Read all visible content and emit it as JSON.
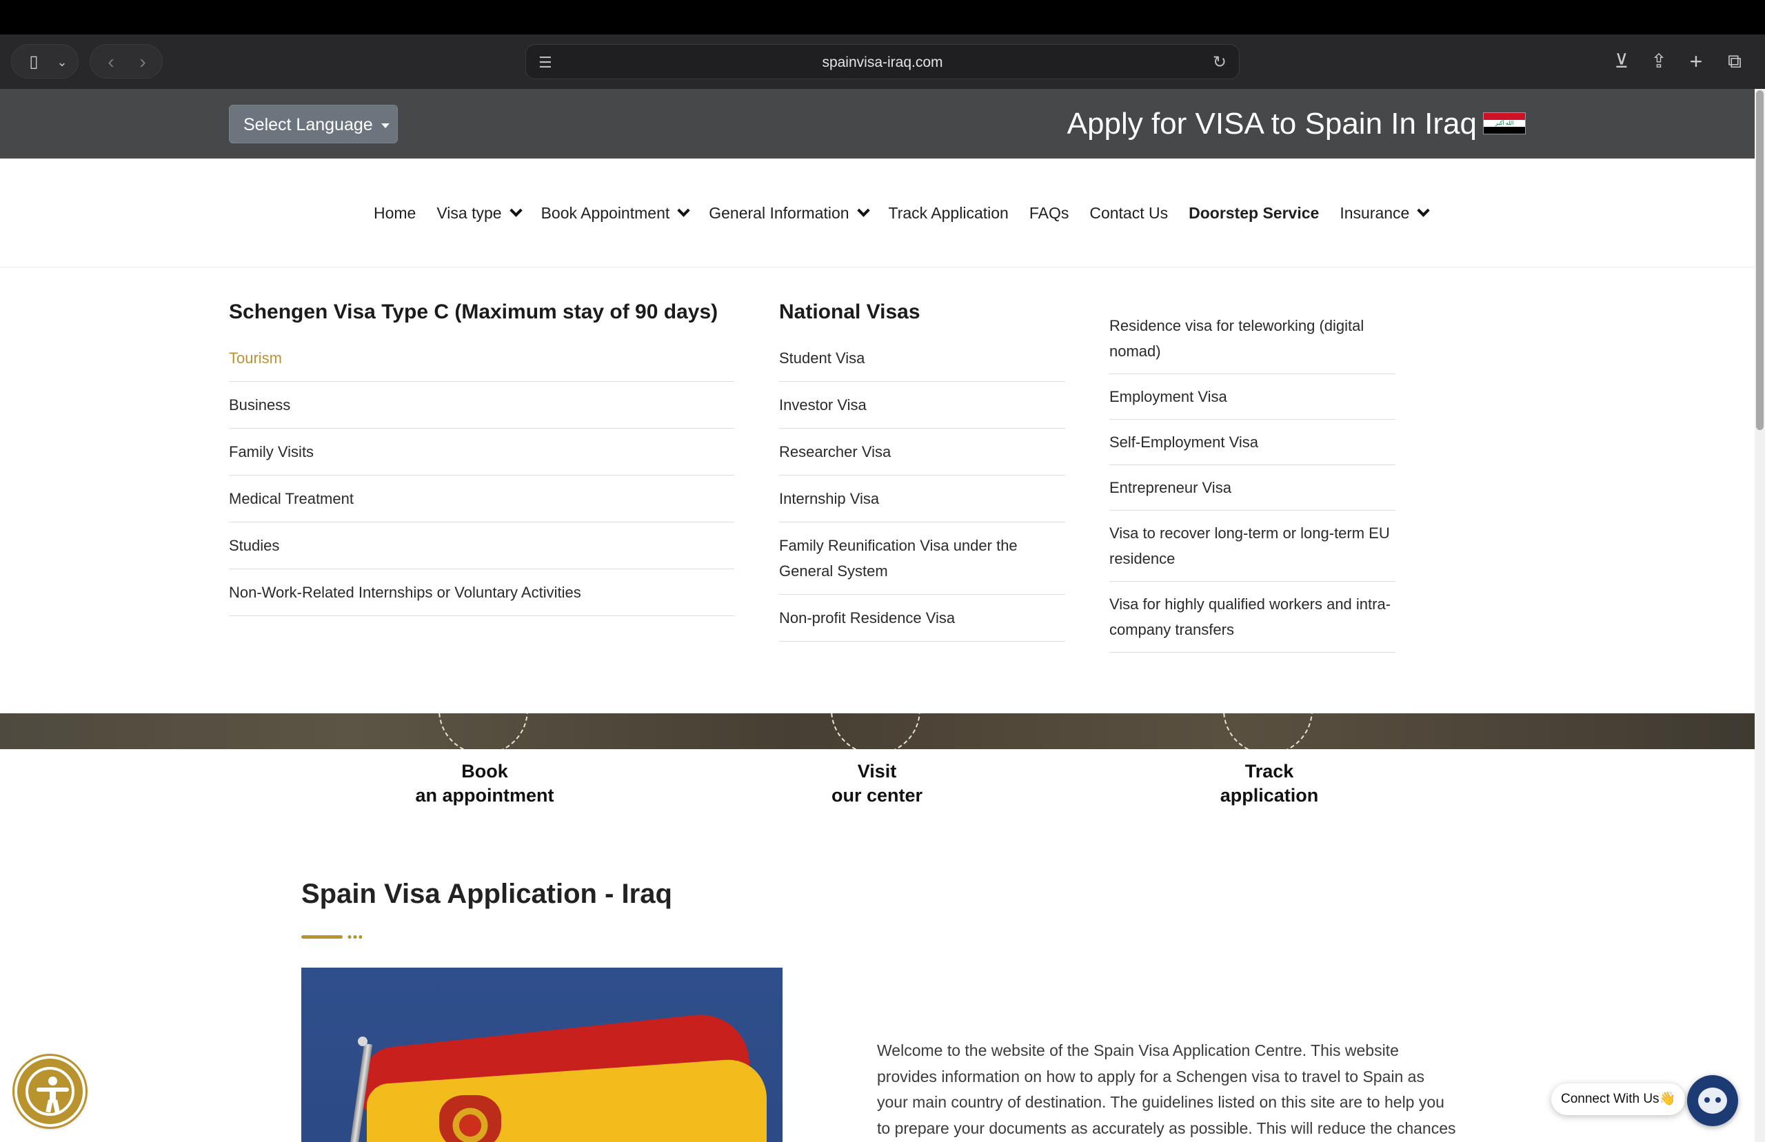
{
  "browser": {
    "url": "spainvisa-iraq.com",
    "icons": {
      "sidebar": "sidebar-icon",
      "back": "back-icon",
      "forward": "forward-icon",
      "reader": "reader-icon",
      "reload": "reload-icon",
      "download": "download-icon",
      "share": "share-icon",
      "new_tab": "plus-icon",
      "tabs": "tabs-icon"
    }
  },
  "header": {
    "language_button": "Select Language",
    "title": "Apply for VISA to Spain In Iraq",
    "flag_icon": "iraq-flag-icon"
  },
  "nav": {
    "items": [
      {
        "label": "Home",
        "dropdown": false,
        "bold": false
      },
      {
        "label": "Visa type",
        "dropdown": true,
        "bold": false
      },
      {
        "label": "Book Appointment",
        "dropdown": true,
        "bold": false
      },
      {
        "label": "General Information",
        "dropdown": true,
        "bold": false
      },
      {
        "label": "Track Application",
        "dropdown": false,
        "bold": false
      },
      {
        "label": "FAQs",
        "dropdown": false,
        "bold": false
      },
      {
        "label": "Contact Us",
        "dropdown": false,
        "bold": false
      },
      {
        "label": "Doorstep Service",
        "dropdown": false,
        "bold": true
      },
      {
        "label": "Insurance",
        "dropdown": true,
        "bold": false
      }
    ]
  },
  "mega_menu": {
    "schengen": {
      "title": "Schengen Visa Type C (Maximum stay of 90 days)",
      "items": [
        "Tourism",
        "Business",
        "Family Visits",
        "Medical Treatment",
        "Studies",
        "Non-Work-Related Internships or Voluntary Activities"
      ],
      "active_index": 0
    },
    "national": {
      "title": "National Visas",
      "items": [
        "Student Visa",
        "Investor Visa",
        "Researcher Visa",
        "Internship Visa",
        "Family Reunification Visa under the General System",
        "Non-profit Residence Visa"
      ]
    },
    "national_more": {
      "items": [
        "Residence visa for teleworking (digital nomad)",
        "Employment Visa",
        "Self-Employment Visa",
        "Entrepreneur Visa",
        "Visa to recover long-term or long-term EU residence",
        "Visa for highly qualified workers and intra-company transfers"
      ]
    }
  },
  "steps": [
    {
      "line1": "Book",
      "line2": "an appointment"
    },
    {
      "line1": "Visit",
      "line2": "our center"
    },
    {
      "line1": "Track",
      "line2": "application"
    }
  ],
  "section": {
    "title": "Spain Visa Application - Iraq",
    "intro": "Welcome to the website of the Spain Visa Application Centre. This website provides information on how to apply for a Schengen visa to travel to Spain as your main country of destination. The guidelines listed on this site are to help you to prepare your documents as accurately as possible. This will reduce the chances of your"
  },
  "widgets": {
    "connect_label": "Connect With Us👋",
    "accessibility_icon": "accessibility-icon",
    "chatbot_icon": "chatbot-icon"
  },
  "colors": {
    "accent_gold": "#b8932e",
    "header_bar": "#464849",
    "language_button": "#6c757d"
  }
}
